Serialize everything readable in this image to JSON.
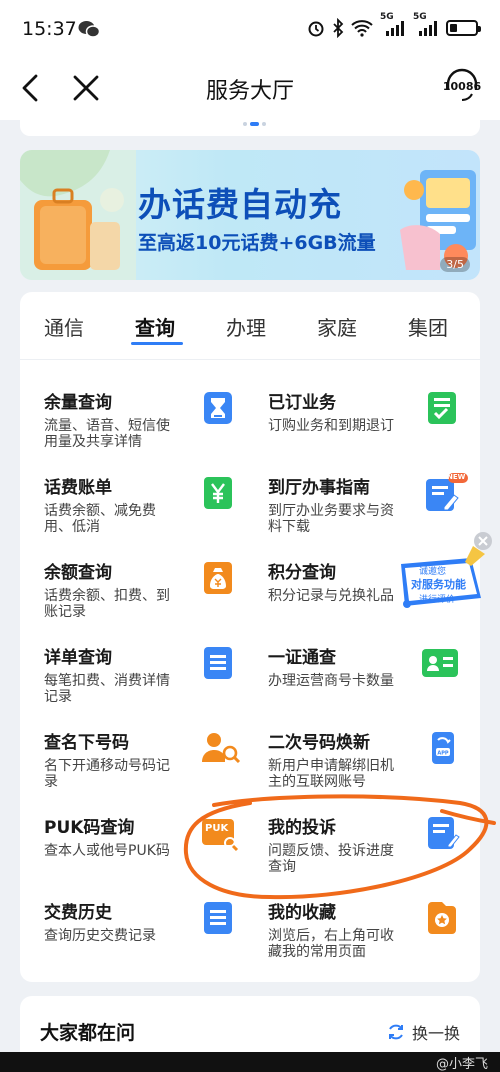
{
  "status_bar": {
    "time": "15:37",
    "network_label_1": "5G",
    "network_label_2": "5G",
    "battery_level": 0.3
  },
  "nav": {
    "title": "服务大厅",
    "service_label": "10086"
  },
  "banner": {
    "title": "办话费自动充",
    "subtitle": "至高返10元话费+6GB流量",
    "page_indicator": "3/5"
  },
  "tabs": [
    {
      "label": "通信",
      "active": false
    },
    {
      "label": "查询",
      "active": true
    },
    {
      "label": "办理",
      "active": false
    },
    {
      "label": "家庭",
      "active": false
    },
    {
      "label": "集团",
      "active": false
    }
  ],
  "items": [
    {
      "title": "余量查询",
      "desc": "流量、语音、短信使用量及共享详情",
      "icon": "hourglass-icon"
    },
    {
      "title": "已订业务",
      "desc": "订购业务和到期退订",
      "icon": "checklist-icon"
    },
    {
      "title": "话费账单",
      "desc": "话费余额、减免费用、低消",
      "icon": "yuan-bill-icon"
    },
    {
      "title": "到厅办事指南",
      "desc": "到厅办业务要求与资料下载",
      "icon": "guide-icon",
      "badge": "NEW"
    },
    {
      "title": "余额查询",
      "desc": "话费余额、扣费、到账记录",
      "icon": "money-bag-icon"
    },
    {
      "title": "积分查询",
      "desc": "积分记录与兑换礼品",
      "icon": "points-icon"
    },
    {
      "title": "详单查询",
      "desc": "每笔扣费、消费详情记录",
      "icon": "list-icon"
    },
    {
      "title": "一证通查",
      "desc": "办理运营商号卡数量",
      "icon": "id-card-icon"
    },
    {
      "title": "查名下号码",
      "desc": "名下开通移动号码记录",
      "icon": "user-search-icon"
    },
    {
      "title": "二次号码焕新",
      "desc": "新用户申请解绑旧机主的互联网账号",
      "icon": "phone-app-icon"
    },
    {
      "title": "PUK码查询",
      "desc": "查本人或他号PUK码",
      "icon": "puk-icon",
      "icon_text": "PUK"
    },
    {
      "title": "我的投诉",
      "desc": "问题反馈、投诉进度查询",
      "icon": "complaint-icon"
    },
    {
      "title": "交费历史",
      "desc": "查询历史交费记录",
      "icon": "history-icon"
    },
    {
      "title": "我的收藏",
      "desc": "浏览后，右上角可收藏我的常用页面",
      "icon": "favorite-icon"
    }
  ],
  "float_badge": {
    "line1": "诚邀您",
    "line2": "对服务功能",
    "line3": "进行评价"
  },
  "ask_section": {
    "title": "大家都在问",
    "refresh_label": "换一换"
  },
  "watermark": "@小李飞",
  "colors": {
    "accent_blue": "#2f7df6",
    "green": "#2bc35a",
    "orange": "#f28a1d",
    "annotation": "#f06a1a"
  }
}
